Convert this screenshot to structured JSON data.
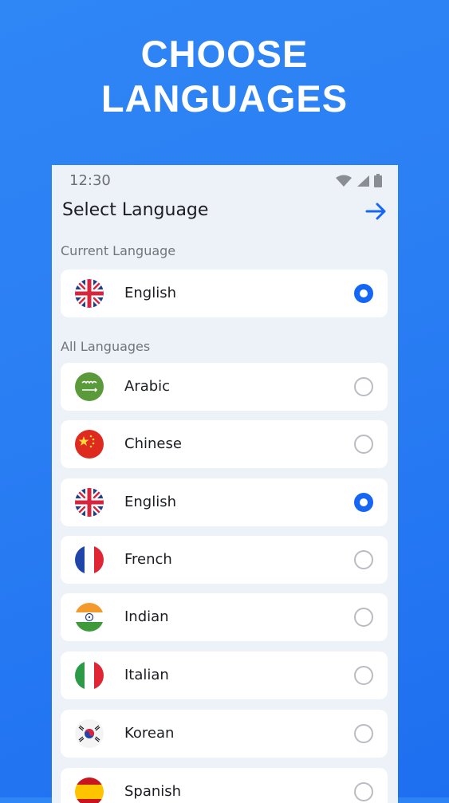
{
  "hero": {
    "title_line1": "CHOOSE",
    "title_line2": "LANGUAGES"
  },
  "status_bar": {
    "time": "12:30",
    "icons": [
      "wifi-icon",
      "signal-icon",
      "battery-icon"
    ]
  },
  "header": {
    "title": "Select Language",
    "next_icon": "arrow-right-icon"
  },
  "current_section": {
    "label": "Current Language",
    "item": {
      "name": "English",
      "flag": "uk-flag-icon",
      "selected": true
    }
  },
  "all_section": {
    "label": "All Languages",
    "items": [
      {
        "name": "Arabic",
        "flag": "saudi-flag-icon",
        "selected": false
      },
      {
        "name": "Chinese",
        "flag": "china-flag-icon",
        "selected": false
      },
      {
        "name": "English",
        "flag": "uk-flag-icon",
        "selected": true
      },
      {
        "name": "French",
        "flag": "france-flag-icon",
        "selected": false
      },
      {
        "name": "Indian",
        "flag": "india-flag-icon",
        "selected": false
      },
      {
        "name": "Italian",
        "flag": "italy-flag-icon",
        "selected": false
      },
      {
        "name": "Korean",
        "flag": "korea-flag-icon",
        "selected": false
      },
      {
        "name": "Spanish",
        "flag": "spain-flag-icon",
        "selected": false
      }
    ]
  },
  "colors": {
    "accent": "#1566f5",
    "background": "#2a7ef3",
    "panel": "#edf2f8",
    "text": "#1b1d22"
  }
}
